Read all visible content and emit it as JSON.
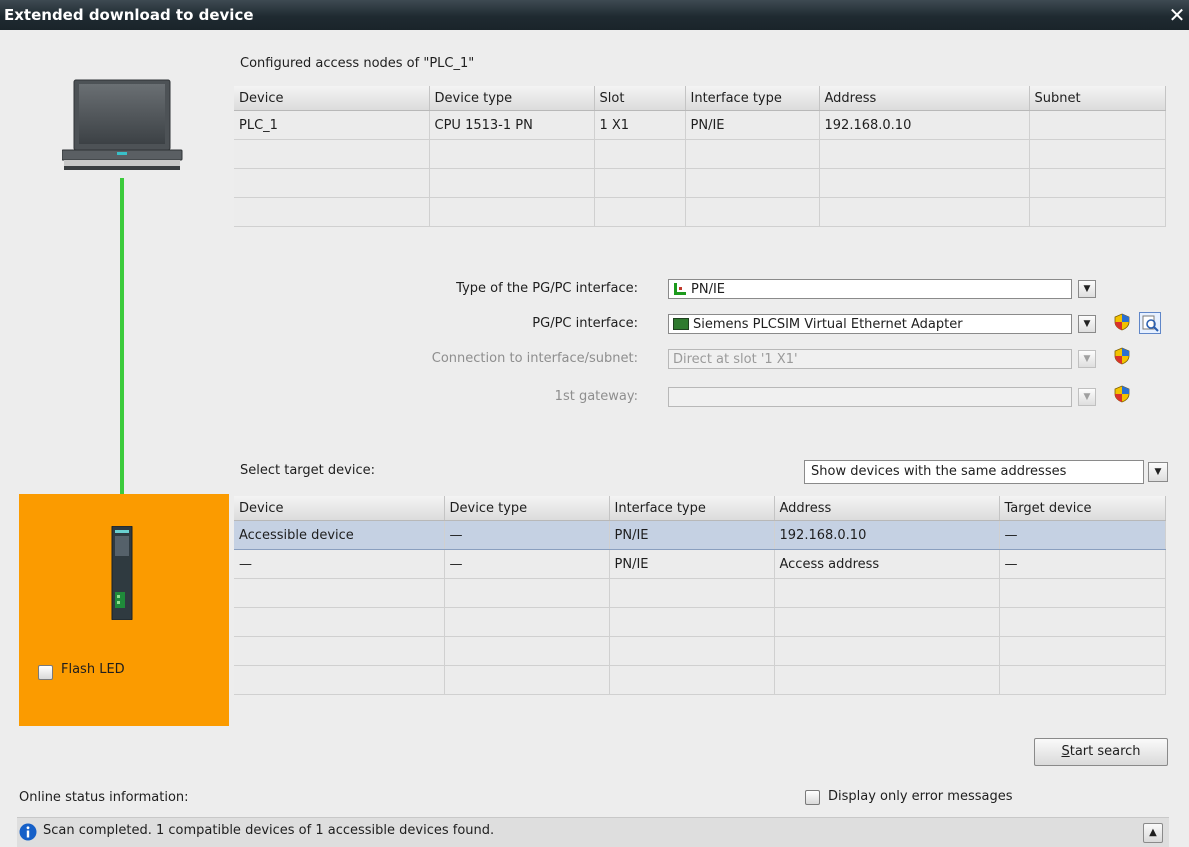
{
  "window": {
    "title": "Extended download to device",
    "close_glyph": "✕"
  },
  "configured": {
    "label": "Configured access nodes of \"PLC_1\"",
    "columns": [
      "Device",
      "Device type",
      "Slot",
      "Interface type",
      "Address",
      "Subnet"
    ],
    "rows": [
      [
        "PLC_1",
        "CPU 1513-1 PN",
        "1 X1",
        "PN/IE",
        "192.168.0.10",
        ""
      ],
      [
        "",
        "",
        "",
        "",
        "",
        ""
      ],
      [
        "",
        "",
        "",
        "",
        "",
        ""
      ],
      [
        "",
        "",
        "",
        "",
        "",
        ""
      ]
    ]
  },
  "interface": {
    "type_label": "Type of the PG/PC interface:",
    "type_value": "PN/IE",
    "pgpc_label": "PG/PC interface:",
    "pgpc_value": "Siemens PLCSIM Virtual Ethernet Adapter",
    "connection_label": "Connection to interface/subnet:",
    "connection_value": "Direct at slot '1 X1'",
    "gateway_label": "1st gateway:",
    "gateway_value": ""
  },
  "target": {
    "label": "Select target device:",
    "filter_value": "Show devices with the same addresses",
    "columns": [
      "Device",
      "Device type",
      "Interface type",
      "Address",
      "Target device"
    ],
    "rows": [
      [
        "Accessible device",
        "—",
        "PN/IE",
        "192.168.0.10",
        "—"
      ],
      [
        "—",
        "—",
        "PN/IE",
        "Access address",
        "—"
      ],
      [
        "",
        "",
        "",
        "",
        ""
      ],
      [
        "",
        "",
        "",
        "",
        ""
      ],
      [
        "",
        "",
        "",
        "",
        ""
      ],
      [
        "",
        "",
        "",
        "",
        ""
      ]
    ],
    "selected_row": 0
  },
  "device_panel": {
    "flash_led_label": "Flash LED",
    "flash_led_checked": false,
    "color": "#fb9b00"
  },
  "search": {
    "button_first": "S",
    "button_rest": "tart search"
  },
  "status": {
    "label": "Online status information:",
    "error_only_label": "Display only error messages",
    "error_only_checked": false,
    "message": "Scan completed. 1 compatible devices of 1 accessible devices found."
  },
  "colors": {
    "link_line": "#3ccb3c",
    "info_icon": "#1660c8"
  }
}
